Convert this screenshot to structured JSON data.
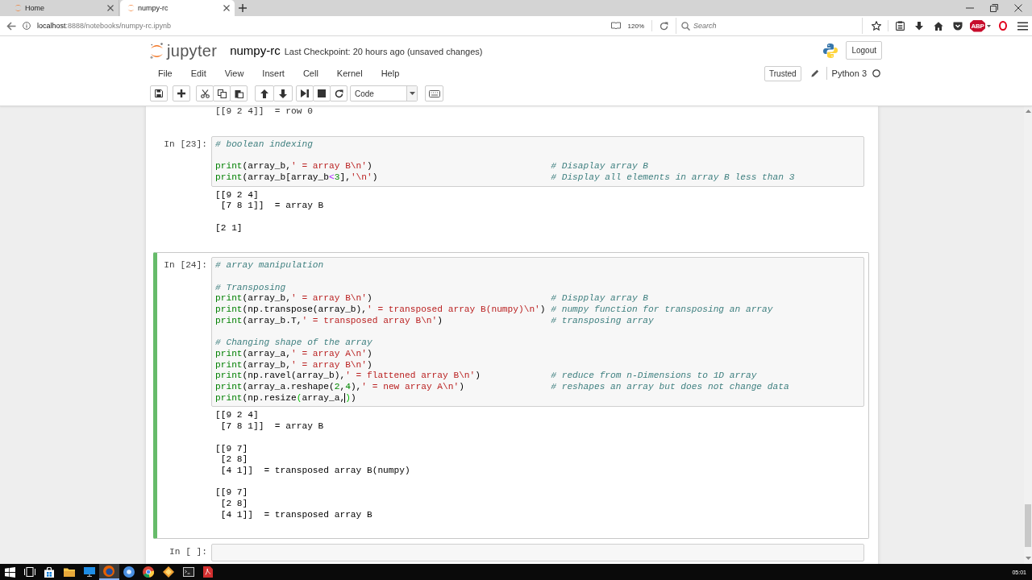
{
  "browser": {
    "tabs": [
      {
        "title": "Home",
        "selected": false
      },
      {
        "title": "numpy-rc",
        "selected": true
      }
    ],
    "url": {
      "host": "localhost",
      "path": ":8888/notebooks/numpy-rc.ipynb"
    },
    "zoom": "120%",
    "search": {
      "placeholder": "Search"
    },
    "extension_badge": "ABP"
  },
  "header": {
    "logo_text": "jupyter",
    "notebook_name": "numpy-rc",
    "checkpoint": "Last Checkpoint: 20 hours ago (unsaved changes)",
    "logout": "Logout"
  },
  "menu": [
    "File",
    "Edit",
    "View",
    "Insert",
    "Cell",
    "Kernel",
    "Help"
  ],
  "kernel": {
    "trusted": "Trusted",
    "name": "Python 3",
    "busy": false
  },
  "toolbar": {
    "cell_type": "Code"
  },
  "previous_output": "[[9 2 4]]  = row 0",
  "cells": [
    {
      "selected": false,
      "prompt": "In [23]:",
      "input": [
        [
          {
            "comment": "# boolean indexing"
          }
        ],
        [
          {
            "code": [
              {
                "kind": "builtin",
                "text": "print"
              },
              {
                "kind": "plain",
                "text": "(array_b,"
              },
              {
                "kind": "string",
                "text": "' = array B\\n'"
              },
              {
                "kind": "plain",
                "text": ")"
              }
            ],
            "comment": "# Disaplay array B"
          },
          {
            "code": [
              {
                "kind": "builtin",
                "text": "print"
              },
              {
                "kind": "plain",
                "text": "(array_b[array_b"
              },
              {
                "kind": "operator",
                "text": "<"
              },
              {
                "kind": "number",
                "text": "3"
              },
              {
                "kind": "plain",
                "text": "],"
              },
              {
                "kind": "string",
                "text": "'\\n'"
              },
              {
                "kind": "plain",
                "text": ")"
              }
            ],
            "comment": "# Display all elements in array B less than 3"
          }
        ]
      ],
      "output": [
        [
          "[[9 2 4]",
          " [7 8 1]]  = array B"
        ],
        [
          "[2 1]"
        ]
      ]
    },
    {
      "selected": true,
      "prompt": "In [24]:",
      "input": [
        [
          {
            "comment": "# array manipulation"
          }
        ],
        [
          {
            "comment": "# Transposing"
          },
          {
            "code": [
              {
                "kind": "builtin",
                "text": "print"
              },
              {
                "kind": "plain",
                "text": "(array_b,"
              },
              {
                "kind": "string",
                "text": "' = array B\\n'"
              },
              {
                "kind": "plain",
                "text": ")"
              }
            ],
            "comment": "# Dispplay array B"
          },
          {
            "code": [
              {
                "kind": "builtin",
                "text": "print"
              },
              {
                "kind": "plain",
                "text": "(np.transpose(array_b),"
              },
              {
                "kind": "string",
                "text": "' = transposed array B(numpy)\\n'"
              },
              {
                "kind": "plain",
                "text": ")"
              }
            ],
            "comment": "# numpy function for transposing an array"
          },
          {
            "code": [
              {
                "kind": "builtin",
                "text": "print"
              },
              {
                "kind": "plain",
                "text": "(array_b.T,"
              },
              {
                "kind": "string",
                "text": "' = transposed array B\\n'"
              },
              {
                "kind": "plain",
                "text": ")"
              }
            ],
            "comment": "# transposing array"
          }
        ],
        [
          {
            "comment": "# Changing shape of the array"
          },
          {
            "code": [
              {
                "kind": "builtin",
                "text": "print"
              },
              {
                "kind": "plain",
                "text": "(array_a,"
              },
              {
                "kind": "string",
                "text": "' = array A\\n'"
              },
              {
                "kind": "plain",
                "text": ")"
              }
            ]
          },
          {
            "code": [
              {
                "kind": "builtin",
                "text": "print"
              },
              {
                "kind": "plain",
                "text": "(array_b,"
              },
              {
                "kind": "string",
                "text": "' = array B\\n'"
              },
              {
                "kind": "plain",
                "text": ")"
              }
            ]
          },
          {
            "code": [
              {
                "kind": "builtin",
                "text": "print"
              },
              {
                "kind": "plain",
                "text": "(np.ravel(array_b),"
              },
              {
                "kind": "string",
                "text": "' = flattened array B\\n'"
              },
              {
                "kind": "plain",
                "text": ")"
              }
            ],
            "comment": "# reduce from n-Dimensions to 1D array"
          },
          {
            "code": [
              {
                "kind": "builtin",
                "text": "print"
              },
              {
                "kind": "plain",
                "text": "(array_a.reshape("
              },
              {
                "kind": "number",
                "text": "2"
              },
              {
                "kind": "plain",
                "text": ","
              },
              {
                "kind": "number",
                "text": "4"
              },
              {
                "kind": "plain",
                "text": "),"
              },
              {
                "kind": "string",
                "text": "' = new array A\\n'"
              },
              {
                "kind": "plain",
                "text": ")"
              }
            ],
            "comment": "# reshapes an array but does not change data"
          },
          {
            "code": [
              {
                "kind": "builtin",
                "text": "print"
              },
              {
                "kind": "plain",
                "text": "(np.resize"
              },
              {
                "kind": "match",
                "text": "("
              },
              {
                "kind": "plain",
                "text": "array_a,"
              },
              {
                "kind": "match",
                "text": ")",
                "cursor_before": true
              },
              {
                "kind": "plain",
                "text": ")"
              }
            ]
          }
        ]
      ],
      "output": [
        [
          "[[9 2 4]",
          " [7 8 1]]  = array B"
        ],
        [
          "[[9 7]",
          " [2 8]",
          " [4 1]]  = transposed array B(numpy)"
        ],
        [
          "[[9 7]",
          " [2 8]",
          " [4 1]]  = transposed array B"
        ]
      ]
    },
    {
      "selected": false,
      "prompt": "In [ ]:"
    }
  ],
  "taskbar": {
    "apps": [
      {
        "selected": false
      },
      {
        "selected": false
      },
      {
        "selected": false
      },
      {
        "selected": true
      },
      {
        "selected": false
      },
      {
        "selected": false
      },
      {
        "selected": false
      },
      {
        "selected": false
      },
      {
        "selected": false
      }
    ],
    "clock": "05:01"
  }
}
